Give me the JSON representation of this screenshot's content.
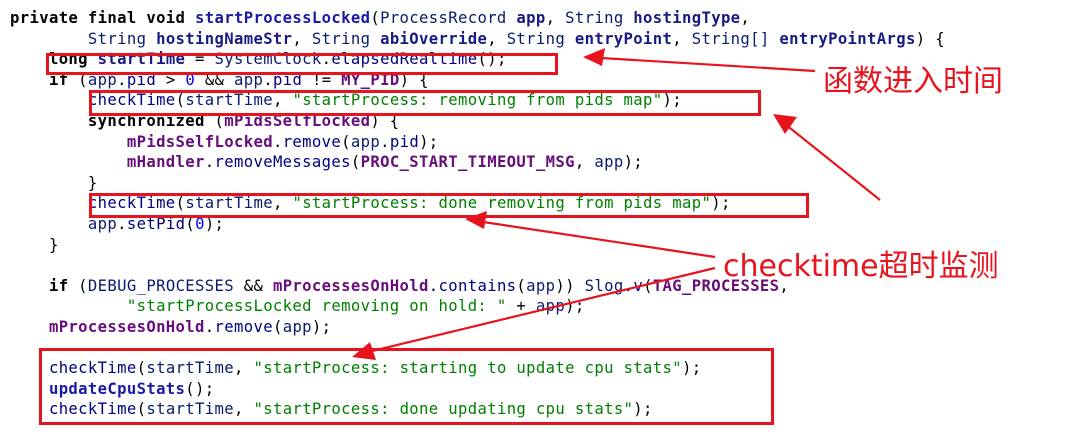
{
  "code": {
    "lines": [
      [
        {
          "t": "kw",
          "v": "private final void "
        },
        {
          "t": "fn",
          "v": "startProcessLocked"
        },
        {
          "t": "pl",
          "v": "("
        },
        {
          "t": "ty",
          "v": "ProcessRecord "
        },
        {
          "t": "var",
          "v": "app"
        },
        {
          "t": "pl",
          "v": ", "
        },
        {
          "t": "ty",
          "v": "String "
        },
        {
          "t": "var",
          "v": "hostingType"
        },
        {
          "t": "pl",
          "v": ","
        }
      ],
      [
        {
          "t": "pl",
          "v": "        "
        },
        {
          "t": "ty",
          "v": "String "
        },
        {
          "t": "var",
          "v": "hostingNameStr"
        },
        {
          "t": "pl",
          "v": ", "
        },
        {
          "t": "ty",
          "v": "String "
        },
        {
          "t": "var",
          "v": "abiOverride"
        },
        {
          "t": "pl",
          "v": ", "
        },
        {
          "t": "ty",
          "v": "String "
        },
        {
          "t": "var",
          "v": "entryPoint"
        },
        {
          "t": "pl",
          "v": ", "
        },
        {
          "t": "ty",
          "v": "String[] "
        },
        {
          "t": "var",
          "v": "entryPointArgs"
        },
        {
          "t": "pl",
          "v": ") {"
        }
      ],
      [
        {
          "t": "pl",
          "v": "    "
        },
        {
          "t": "kw",
          "v": "long "
        },
        {
          "t": "var",
          "v": "startTime"
        },
        {
          "t": "pl",
          "v": " = "
        },
        {
          "t": "ty",
          "v": "SystemClock"
        },
        {
          "t": "pl",
          "v": "."
        },
        {
          "t": "mth",
          "v": "elapsedRealtime"
        },
        {
          "t": "pl",
          "v": "();"
        }
      ],
      [
        {
          "t": "pl",
          "v": "    "
        },
        {
          "t": "kw",
          "v": "if"
        },
        {
          "t": "pl",
          "v": " ("
        },
        {
          "t": "ty",
          "v": "app"
        },
        {
          "t": "pl",
          "v": "."
        },
        {
          "t": "mth",
          "v": "pid"
        },
        {
          "t": "pl",
          "v": " > "
        },
        {
          "t": "num",
          "v": "0"
        },
        {
          "t": "pl",
          "v": " && "
        },
        {
          "t": "ty",
          "v": "app"
        },
        {
          "t": "pl",
          "v": "."
        },
        {
          "t": "mth",
          "v": "pid"
        },
        {
          "t": "pl",
          "v": " != "
        },
        {
          "t": "cst",
          "v": "MY_PID"
        },
        {
          "t": "pl",
          "v": ") {"
        }
      ],
      [
        {
          "t": "pl",
          "v": "        "
        },
        {
          "t": "mth",
          "v": "checkTime"
        },
        {
          "t": "pl",
          "v": "("
        },
        {
          "t": "ty",
          "v": "startTime"
        },
        {
          "t": "pl",
          "v": ", "
        },
        {
          "t": "str",
          "v": "\"startProcess: removing from pids map\""
        },
        {
          "t": "pl",
          "v": ");"
        }
      ],
      [
        {
          "t": "pl",
          "v": "        "
        },
        {
          "t": "kw",
          "v": "synchronized"
        },
        {
          "t": "pl",
          "v": " ("
        },
        {
          "t": "fld",
          "v": "mPidsSelfLocked"
        },
        {
          "t": "pl",
          "v": ") {"
        }
      ],
      [
        {
          "t": "pl",
          "v": "            "
        },
        {
          "t": "fld",
          "v": "mPidsSelfLocked"
        },
        {
          "t": "pl",
          "v": "."
        },
        {
          "t": "mth",
          "v": "remove"
        },
        {
          "t": "pl",
          "v": "("
        },
        {
          "t": "ty",
          "v": "app"
        },
        {
          "t": "pl",
          "v": "."
        },
        {
          "t": "mth",
          "v": "pid"
        },
        {
          "t": "pl",
          "v": ");"
        }
      ],
      [
        {
          "t": "pl",
          "v": "            "
        },
        {
          "t": "fld",
          "v": "mHandler"
        },
        {
          "t": "pl",
          "v": "."
        },
        {
          "t": "mth",
          "v": "removeMessages"
        },
        {
          "t": "pl",
          "v": "("
        },
        {
          "t": "cst",
          "v": "PROC_START_TIMEOUT_MSG"
        },
        {
          "t": "pl",
          "v": ", "
        },
        {
          "t": "ty",
          "v": "app"
        },
        {
          "t": "pl",
          "v": ");"
        }
      ],
      [
        {
          "t": "pl",
          "v": "        }"
        }
      ],
      [
        {
          "t": "pl",
          "v": "        "
        },
        {
          "t": "mth",
          "v": "checkTime"
        },
        {
          "t": "pl",
          "v": "("
        },
        {
          "t": "ty",
          "v": "startTime"
        },
        {
          "t": "pl",
          "v": ", "
        },
        {
          "t": "str",
          "v": "\"startProcess: done removing from pids map\""
        },
        {
          "t": "pl",
          "v": ");"
        }
      ],
      [
        {
          "t": "pl",
          "v": "        "
        },
        {
          "t": "ty",
          "v": "app"
        },
        {
          "t": "pl",
          "v": "."
        },
        {
          "t": "mth",
          "v": "setPid"
        },
        {
          "t": "pl",
          "v": "("
        },
        {
          "t": "num",
          "v": "0"
        },
        {
          "t": "pl",
          "v": ");"
        }
      ],
      [
        {
          "t": "pl",
          "v": "    }"
        }
      ],
      [],
      [
        {
          "t": "pl",
          "v": "    "
        },
        {
          "t": "kw",
          "v": "if"
        },
        {
          "t": "pl",
          "v": " ("
        },
        {
          "t": "ty",
          "v": "DEBUG_PROCESSES"
        },
        {
          "t": "pl",
          "v": " && "
        },
        {
          "t": "fld",
          "v": "mProcessesOnHold"
        },
        {
          "t": "pl",
          "v": "."
        },
        {
          "t": "mth",
          "v": "contains"
        },
        {
          "t": "pl",
          "v": "("
        },
        {
          "t": "ty",
          "v": "app"
        },
        {
          "t": "pl",
          "v": ")) "
        },
        {
          "t": "ty",
          "v": "Slog"
        },
        {
          "t": "pl",
          "v": "."
        },
        {
          "t": "mth",
          "v": "v"
        },
        {
          "t": "pl",
          "v": "("
        },
        {
          "t": "cst",
          "v": "TAG_PROCESSES"
        },
        {
          "t": "pl",
          "v": ","
        }
      ],
      [
        {
          "t": "pl",
          "v": "            "
        },
        {
          "t": "str",
          "v": "\"startProcessLocked removing on hold: \""
        },
        {
          "t": "pl",
          "v": " + "
        },
        {
          "t": "ty",
          "v": "app"
        },
        {
          "t": "pl",
          "v": ");"
        }
      ],
      [
        {
          "t": "pl",
          "v": "    "
        },
        {
          "t": "fld",
          "v": "mProcessesOnHold"
        },
        {
          "t": "pl",
          "v": "."
        },
        {
          "t": "mth",
          "v": "remove"
        },
        {
          "t": "pl",
          "v": "("
        },
        {
          "t": "ty",
          "v": "app"
        },
        {
          "t": "pl",
          "v": ");"
        }
      ],
      [],
      [
        {
          "t": "pl",
          "v": "    "
        },
        {
          "t": "mth",
          "v": "checkTime"
        },
        {
          "t": "pl",
          "v": "("
        },
        {
          "t": "ty",
          "v": "startTime"
        },
        {
          "t": "pl",
          "v": ", "
        },
        {
          "t": "str",
          "v": "\"startProcess: starting to update cpu stats\""
        },
        {
          "t": "pl",
          "v": ");"
        }
      ],
      [
        {
          "t": "pl",
          "v": "    "
        },
        {
          "t": "fn",
          "v": "updateCpuStats"
        },
        {
          "t": "pl",
          "v": "();"
        }
      ],
      [
        {
          "t": "pl",
          "v": "    "
        },
        {
          "t": "mth",
          "v": "checkTime"
        },
        {
          "t": "pl",
          "v": "("
        },
        {
          "t": "ty",
          "v": "startTime"
        },
        {
          "t": "pl",
          "v": ", "
        },
        {
          "t": "str",
          "v": "\"startProcess: done updating cpu stats\""
        },
        {
          "t": "pl",
          "v": ");"
        }
      ]
    ]
  },
  "annotations": {
    "entry_time_label": "函数进入时间",
    "checktime_label": "checktime超时监测"
  },
  "colors": {
    "annotation_red": "#e8141d",
    "keyword": "#000000",
    "method_decl": "#1a1aa6",
    "field": "#660e7a",
    "string": "#008000",
    "number": "#0000ff"
  }
}
